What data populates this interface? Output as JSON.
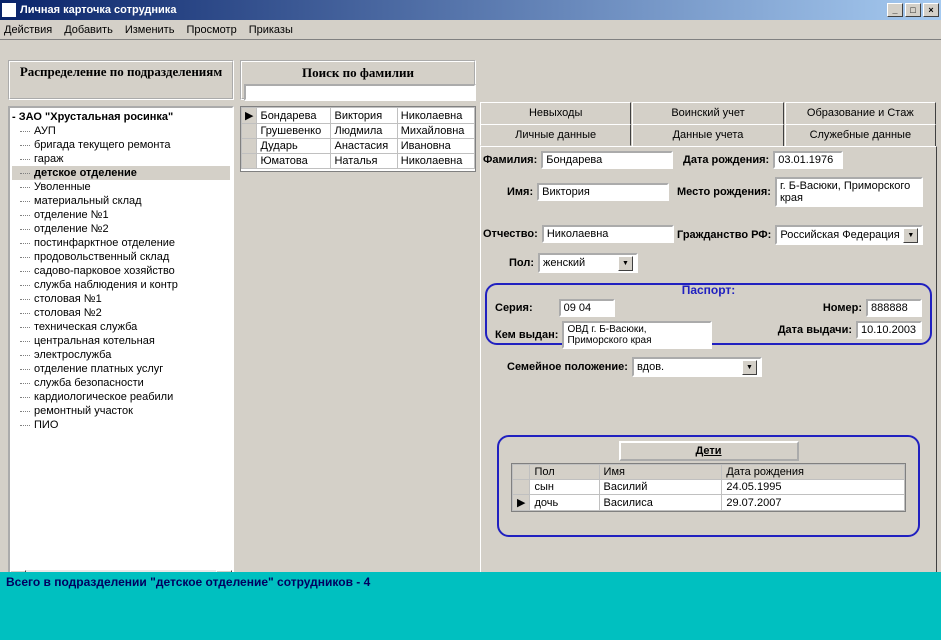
{
  "window": {
    "title": "Личная карточка сотрудника"
  },
  "menu": {
    "items": [
      "Действия",
      "Добавить",
      "Изменить",
      "Просмотр",
      "Приказы"
    ]
  },
  "left": {
    "header": "Распределение по подразделениям"
  },
  "search": {
    "header": "Поиск по фамилии",
    "value": ""
  },
  "tree": {
    "root": "ЗАО \"Хрустальная росинка\"",
    "items": [
      "АУП",
      "бригада текущего ремонта",
      "гараж",
      "детское отделение",
      "Уволенные",
      "материальный склад",
      "отделение №1",
      "отделение №2",
      "постинфарктное отделение",
      "продовольственный склад",
      "садово-парковое хозяйство",
      "служба наблюдения и контр",
      "столовая №1",
      "столовая №2",
      "техническая служба",
      "центральная котельная",
      "электрослужба",
      "отделение платных услуг",
      "служба безопасности",
      "кардиологическое реабили",
      "ремонтный участок",
      "ПИО"
    ],
    "selected_index": 3
  },
  "emp_grid": {
    "rows": [
      [
        "Бондарева",
        "Виктория",
        "Николаевна"
      ],
      [
        "Грушевенко",
        "Людмила",
        "Михайловна"
      ],
      [
        "Дударь",
        "Анастасия",
        "Ивановна"
      ],
      [
        "Юматова",
        "Наталья",
        "Николаевна"
      ]
    ]
  },
  "tabs_top": [
    "Невыходы",
    "Воинский учет",
    "Образование и Стаж"
  ],
  "tabs_bottom": [
    "Личные данные",
    "Данные учета",
    "Служебные данные"
  ],
  "form": {
    "surname_lbl": "Фамилия:",
    "surname": "Бондарева",
    "dob_lbl": "Дата рождения:",
    "dob": "03.01.1976",
    "name_lbl": "Имя:",
    "name": "Виктория",
    "pob_lbl": "Место рождения:",
    "pob": "г. Б-Васюки, Приморского края",
    "patr_lbl": "Отчество:",
    "patr": "Николаевна",
    "cit_lbl": "Гражданство РФ:",
    "cit": "Российская Федерация",
    "sex_lbl": "Пол:",
    "sex": "женский",
    "marital_lbl": "Семейное положение:",
    "marital": "вдов."
  },
  "passport": {
    "title": "Паспорт:",
    "series_lbl": "Серия:",
    "series": "09 04",
    "number_lbl": "Номер:",
    "number": "888888",
    "issued_lbl": "Кем выдан:",
    "issued": "ОВД г. Б-Васюки, Приморского края",
    "date_lbl": "Дата выдачи:",
    "date": "10.10.2003"
  },
  "children": {
    "title": "Дети",
    "headers": [
      "Пол",
      "Имя",
      "Дата рождения"
    ],
    "rows": [
      [
        "сын",
        "Василий",
        "24.05.1995"
      ],
      [
        "дочь",
        "Василиса",
        "29.07.2007"
      ]
    ]
  },
  "status": "Всего в подразделении \"детское отделение\" сотрудников - 4"
}
